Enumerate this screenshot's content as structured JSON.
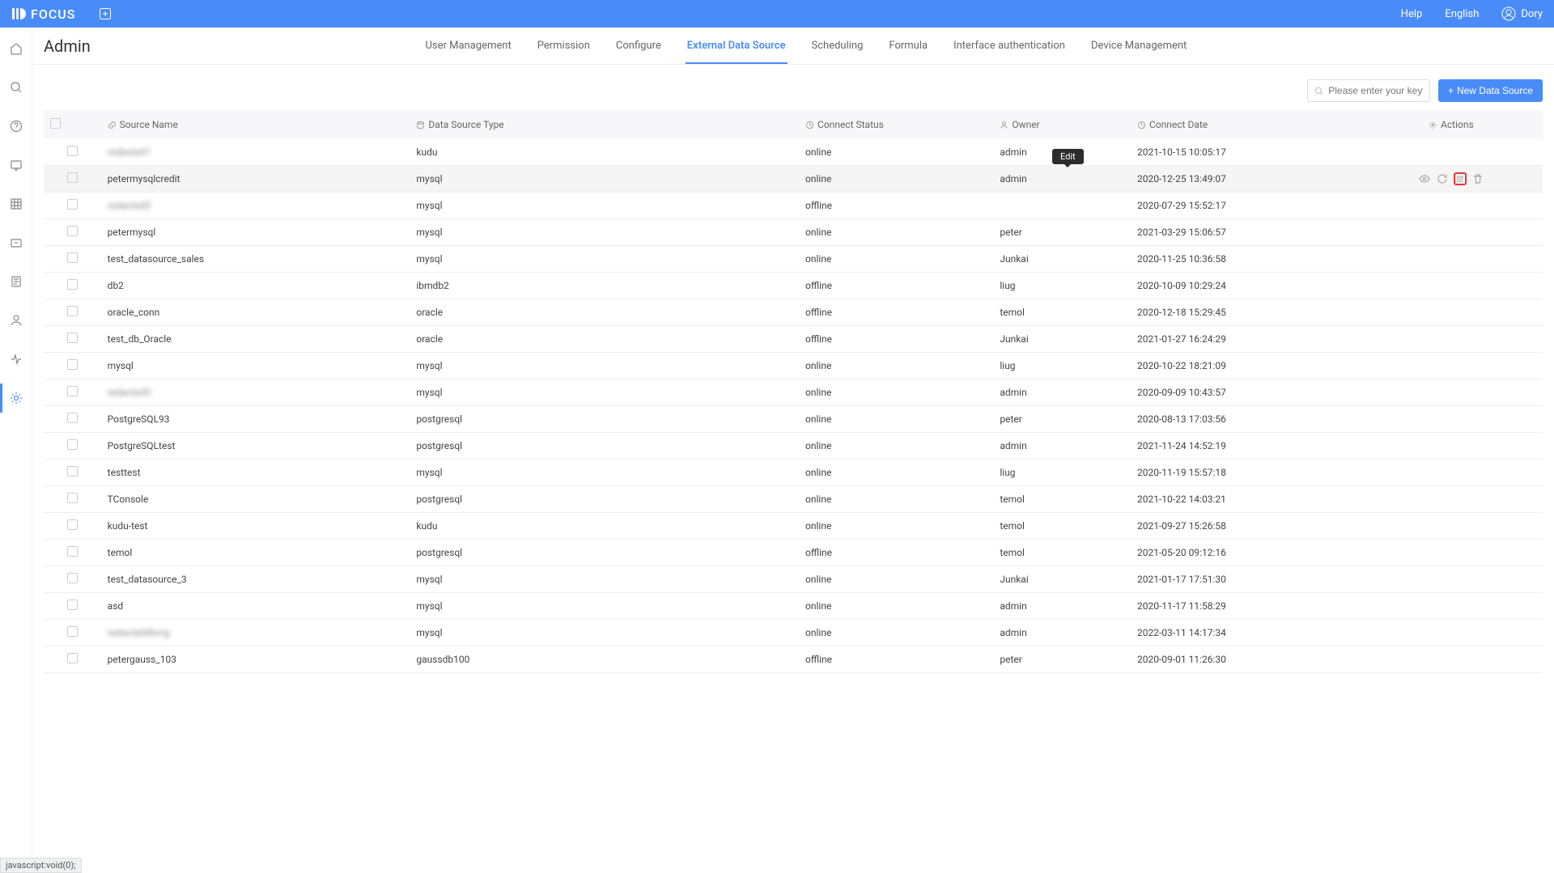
{
  "brand": "FOCUS",
  "header": {
    "help": "Help",
    "language": "English",
    "user": "Dory"
  },
  "page_title": "Admin",
  "tabs": [
    {
      "label": "User Management",
      "active": false
    },
    {
      "label": "Permission",
      "active": false
    },
    {
      "label": "Configure",
      "active": false
    },
    {
      "label": "External Data Source",
      "active": true
    },
    {
      "label": "Scheduling",
      "active": false
    },
    {
      "label": "Formula",
      "active": false
    },
    {
      "label": "Interface authentication",
      "active": false
    },
    {
      "label": "Device Management",
      "active": false
    }
  ],
  "toolbar": {
    "search_placeholder": "Please enter your keywor",
    "new_button": "New Data Source"
  },
  "columns": {
    "name": "Source Name",
    "type": "Data Source Type",
    "status": "Connect Status",
    "owner": "Owner",
    "date": "Connect Date",
    "actions": "Actions"
  },
  "tooltip": "Edit",
  "status_bar": "javascript:void(0);",
  "rows": [
    {
      "name": "redacted1",
      "blurred": true,
      "type": "kudu",
      "status": "online",
      "owner": "admin",
      "date": "2021-10-15 10:05:17",
      "hover": false
    },
    {
      "name": "petermysqlcredit",
      "blurred": false,
      "type": "mysql",
      "status": "online",
      "owner": "admin",
      "date": "2020-12-25 13:49:07",
      "hover": true
    },
    {
      "name": "redacted2",
      "blurred": true,
      "type": "mysql",
      "status": "offline",
      "owner": "",
      "date": "2020-07-29 15:52:17",
      "hover": false
    },
    {
      "name": "petermysql",
      "blurred": false,
      "type": "mysql",
      "status": "online",
      "owner": "peter",
      "date": "2021-03-29 15:06:57",
      "hover": false
    },
    {
      "name": "test_datasource_sales",
      "blurred": false,
      "type": "mysql",
      "status": "online",
      "owner": "Junkai",
      "date": "2020-11-25 10:36:58",
      "hover": false
    },
    {
      "name": "db2",
      "blurred": false,
      "type": "ibmdb2",
      "status": "offline",
      "owner": "liug",
      "date": "2020-10-09 10:29:24",
      "hover": false
    },
    {
      "name": "oracle_conn",
      "blurred": false,
      "type": "oracle",
      "status": "offline",
      "owner": "temol",
      "date": "2020-12-18 15:29:45",
      "hover": false
    },
    {
      "name": "test_db_Oracle",
      "blurred": false,
      "type": "oracle",
      "status": "offline",
      "owner": "Junkai",
      "date": "2021-01-27 16:24:29",
      "hover": false
    },
    {
      "name": "mysql",
      "blurred": false,
      "type": "mysql",
      "status": "online",
      "owner": "liug",
      "date": "2020-10-22 18:21:09",
      "hover": false
    },
    {
      "name": "redacted3",
      "blurred": true,
      "type": "mysql",
      "status": "online",
      "owner": "admin",
      "date": "2020-09-09 10:43:57",
      "hover": false
    },
    {
      "name": "PostgreSQL93",
      "blurred": false,
      "type": "postgresql",
      "status": "online",
      "owner": "peter",
      "date": "2020-08-13 17:03:56",
      "hover": false
    },
    {
      "name": "PostgreSQLtest",
      "blurred": false,
      "type": "postgresql",
      "status": "online",
      "owner": "admin",
      "date": "2021-11-24 14:52:19",
      "hover": false
    },
    {
      "name": "testtest",
      "blurred": false,
      "type": "mysql",
      "status": "online",
      "owner": "liug",
      "date": "2020-11-19 15:57:18",
      "hover": false
    },
    {
      "name": "TConsole",
      "blurred": false,
      "type": "postgresql",
      "status": "online",
      "owner": "temol",
      "date": "2021-10-22 14:03:21",
      "hover": false
    },
    {
      "name": "kudu-test",
      "blurred": false,
      "type": "kudu",
      "status": "online",
      "owner": "temol",
      "date": "2021-09-27 15:26:58",
      "hover": false
    },
    {
      "name": "temol",
      "blurred": false,
      "type": "postgresql",
      "status": "offline",
      "owner": "temol",
      "date": "2021-05-20 09:12:16",
      "hover": false
    },
    {
      "name": "test_datasource_3",
      "blurred": false,
      "type": "mysql",
      "status": "online",
      "owner": "Junkai",
      "date": "2021-01-17 17:51:30",
      "hover": false
    },
    {
      "name": "asd",
      "blurred": false,
      "type": "mysql",
      "status": "online",
      "owner": "admin",
      "date": "2020-11-17 11:58:29",
      "hover": false
    },
    {
      "name": "redacted4long",
      "blurred": true,
      "type": "mysql",
      "status": "online",
      "owner": "admin",
      "date": "2022-03-11 14:17:34",
      "hover": false
    },
    {
      "name": "petergauss_103",
      "blurred": false,
      "type": "gaussdb100",
      "status": "offline",
      "owner": "peter",
      "date": "2020-09-01 11:26:30",
      "hover": false
    }
  ]
}
